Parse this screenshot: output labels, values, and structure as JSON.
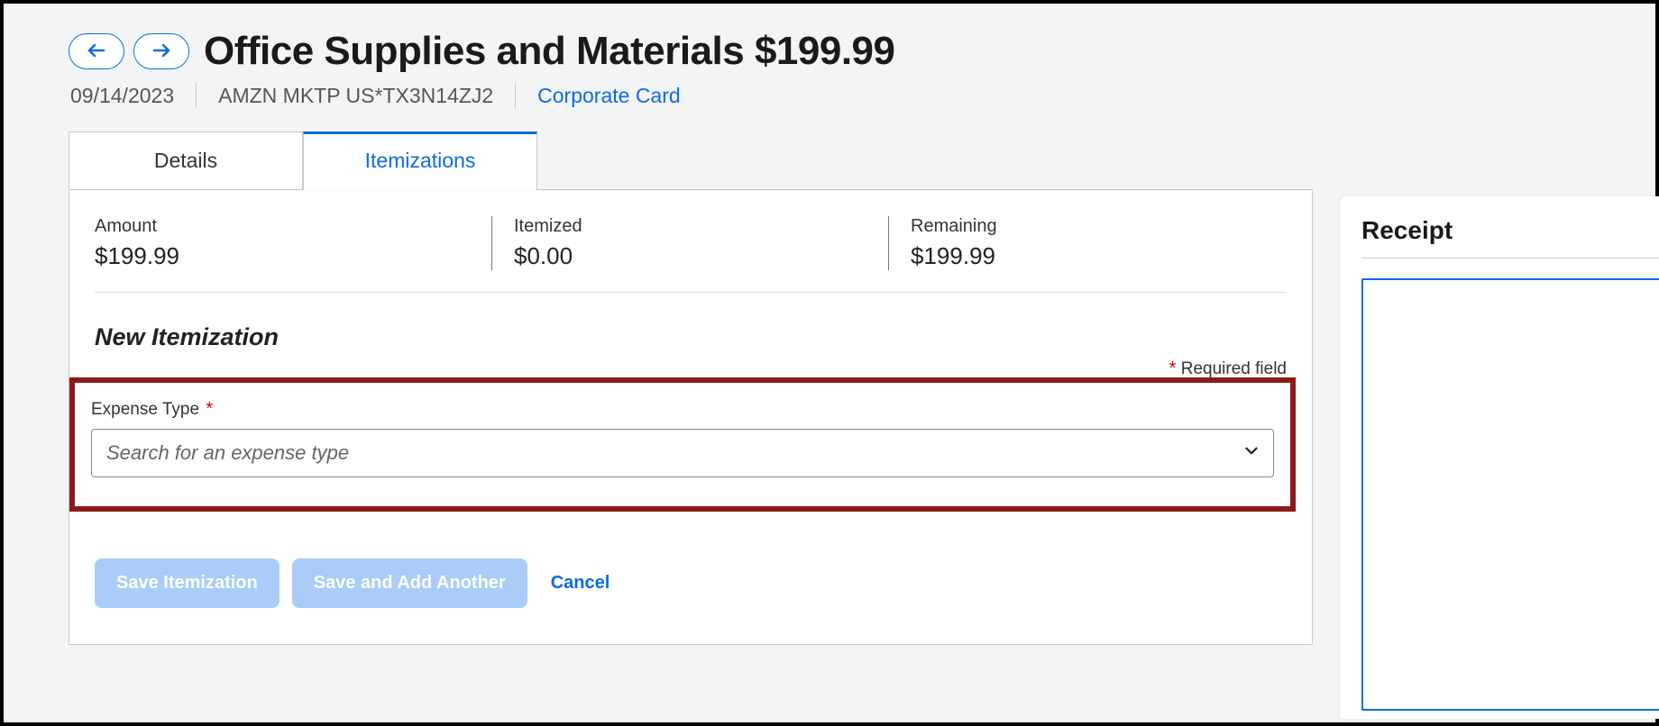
{
  "header": {
    "title": "Office Supplies and Materials $199.99",
    "date": "09/14/2023",
    "merchant": "AMZN MKTP US*TX3N14ZJ2",
    "payment_method": "Corporate Card"
  },
  "tabs": {
    "details": "Details",
    "itemizations": "Itemizations"
  },
  "summary": {
    "amount_label": "Amount",
    "amount_value": "$199.99",
    "itemized_label": "Itemized",
    "itemized_value": "$0.00",
    "remaining_label": "Remaining",
    "remaining_value": "$199.99"
  },
  "section": {
    "heading": "New Itemization",
    "required_legend": "Required field"
  },
  "field": {
    "expense_type_label": "Expense Type",
    "expense_type_placeholder": "Search for an expense type"
  },
  "actions": {
    "save": "Save Itemization",
    "save_add": "Save and Add Another",
    "cancel": "Cancel"
  },
  "receipt": {
    "title": "Receipt"
  }
}
